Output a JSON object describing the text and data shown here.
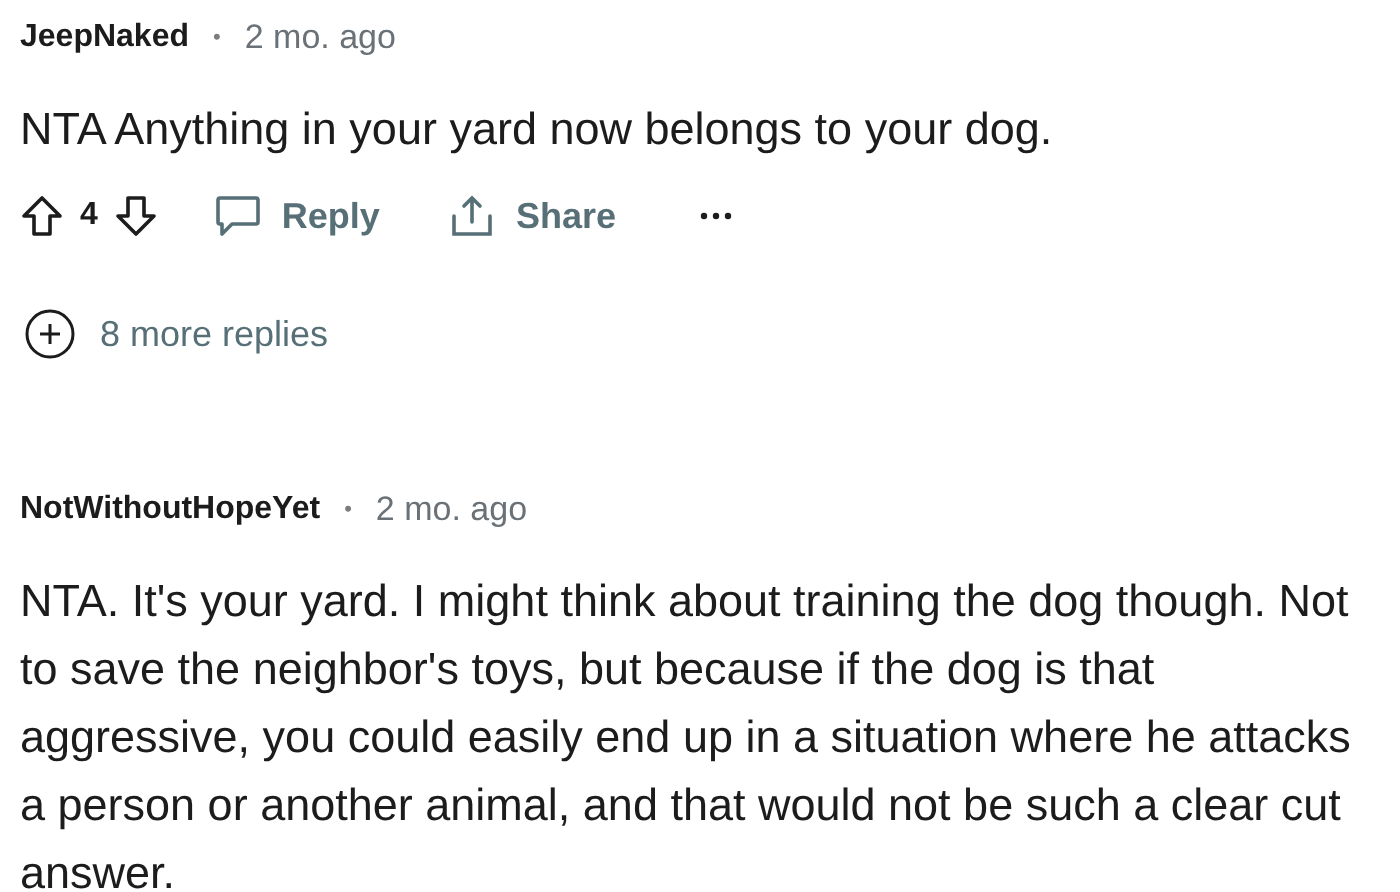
{
  "comments": [
    {
      "author": "JeepNaked",
      "separator": "•",
      "time": "2 mo. ago",
      "body": "NTA Anything in your yard now belongs to your dog.",
      "votes": "4",
      "actions": [
        {
          "kind": "reply",
          "label": "Reply"
        },
        {
          "kind": "share",
          "label": "Share"
        },
        {
          "kind": "more"
        }
      ],
      "more_replies": "8 more replies"
    },
    {
      "author": "NotWithoutHopeYet",
      "separator": "•",
      "time": "2 mo. ago",
      "body": "NTA. It's your yard. I might think about training the dog though. Not to save the neighbor's toys, but because if the dog is that aggressive, you could easily end up in a situation where he attacks a person or another animal, and that would not be such a clear cut answer."
    }
  ]
}
